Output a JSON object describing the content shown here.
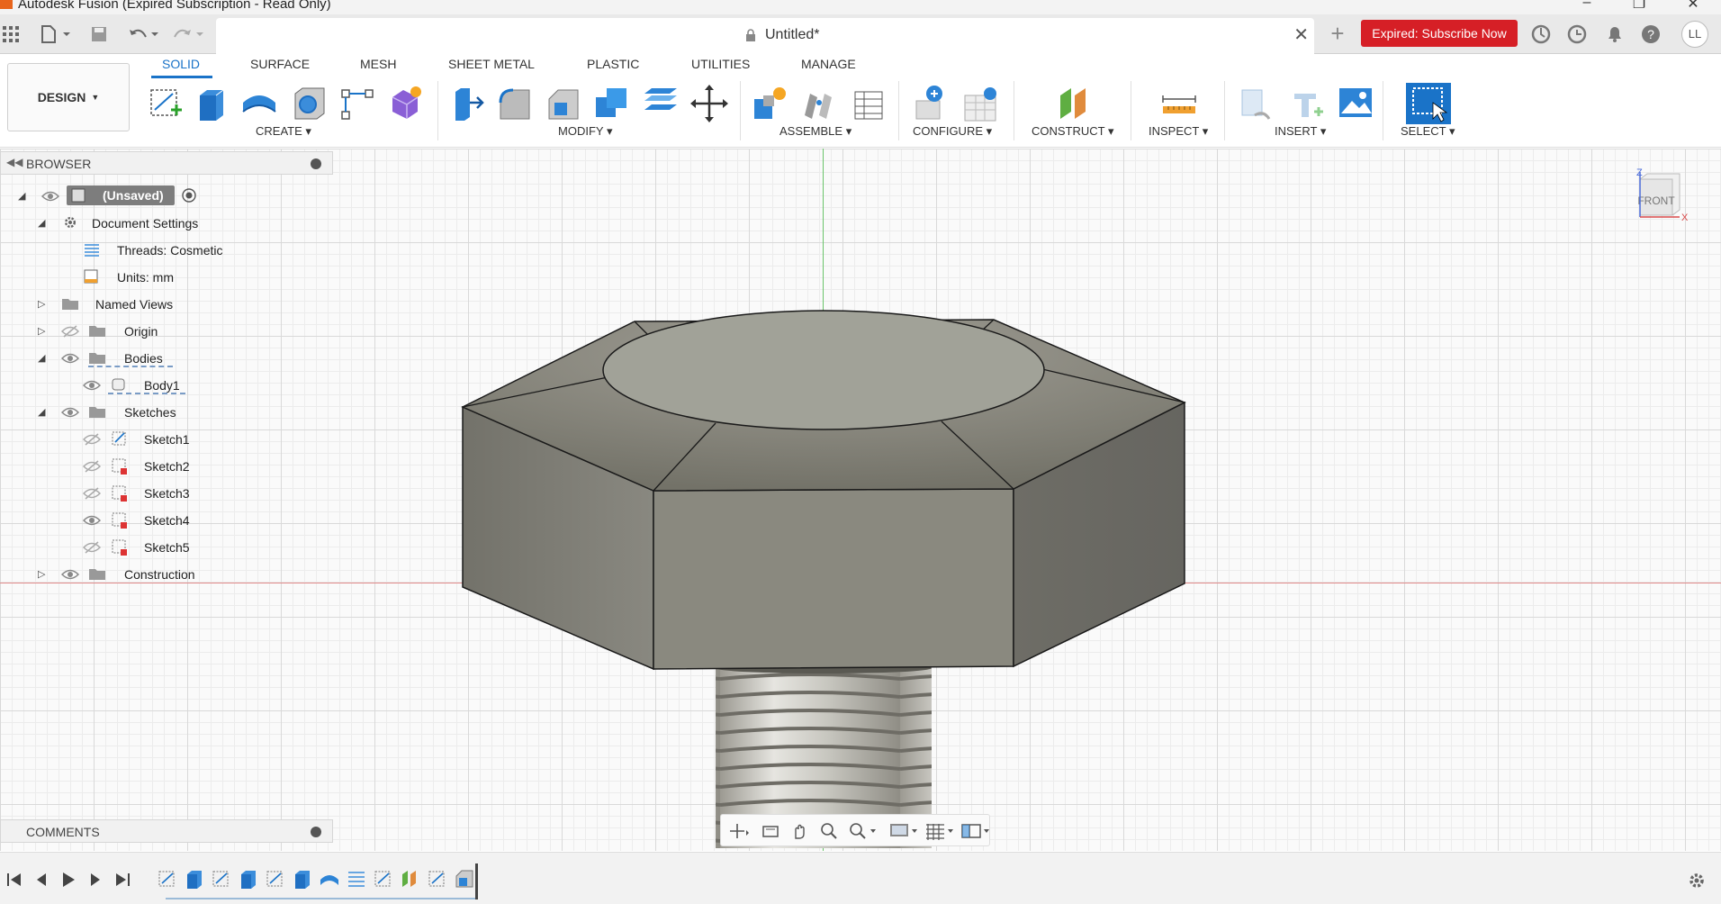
{
  "window": {
    "title": "Autodesk Fusion (Expired Subscription - Read Only)"
  },
  "tabbar": {
    "doc_title": "Untitled*",
    "subscribe_label": "Expired: Subscribe Now",
    "avatar_initials": "LL"
  },
  "ribbon": {
    "workspace": "DESIGN",
    "tabs": [
      "SOLID",
      "SURFACE",
      "MESH",
      "SHEET METAL",
      "PLASTIC",
      "UTILITIES",
      "MANAGE"
    ],
    "groups": [
      "CREATE",
      "MODIFY",
      "ASSEMBLE",
      "CONFIGURE",
      "CONSTRUCT",
      "INSPECT",
      "INSERT",
      "SELECT"
    ]
  },
  "browser": {
    "header": "BROWSER",
    "root": "(Unsaved)",
    "document_settings": "Document Settings",
    "threads": "Threads: Cosmetic",
    "units": "Units: mm",
    "named_views": "Named Views",
    "origin": "Origin",
    "bodies": "Bodies",
    "body1": "Body1",
    "sketches": "Sketches",
    "sketch_items": [
      "Sketch1",
      "Sketch2",
      "Sketch3",
      "Sketch4",
      "Sketch5"
    ],
    "construction": "Construction"
  },
  "comments": {
    "header": "COMMENTS"
  },
  "viewcube": {
    "face": "FRONT",
    "axis_z": "Z",
    "axis_x": "X"
  },
  "colors": {
    "accent": "#1a73c8",
    "subscribe": "#d61f26",
    "model_face": "#7c7b72",
    "model_top": "#a3a49a"
  }
}
